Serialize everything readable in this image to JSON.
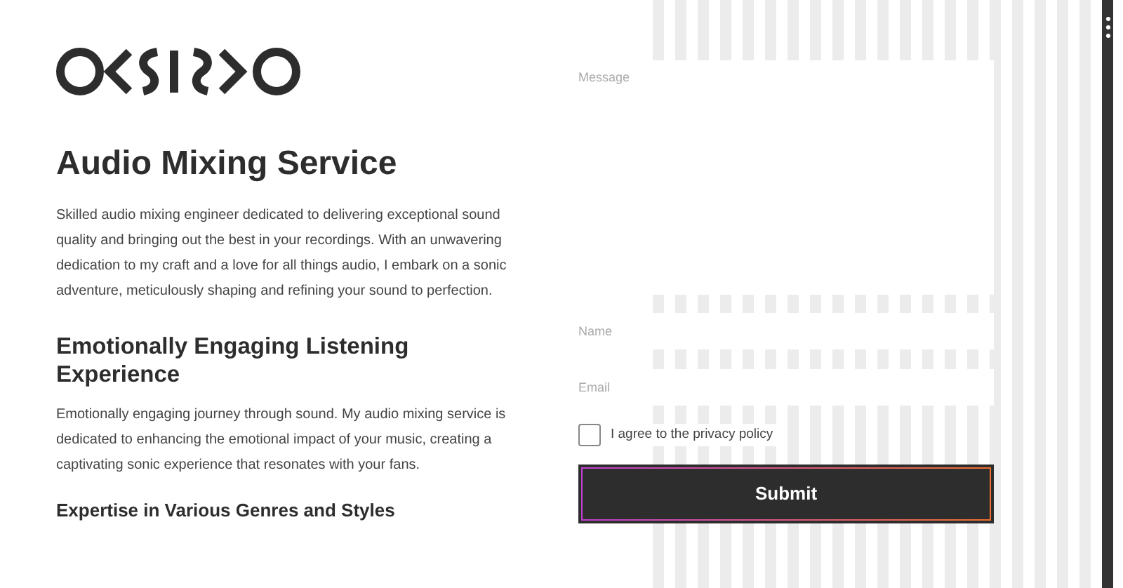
{
  "title": "Audio Mixing Service",
  "intro": "Skilled audio mixing engineer dedicated to delivering exceptional sound quality and bringing out the best in your recordings. With an unwavering dedication to my craft and a love for all things audio, I embark on a sonic adventure, meticulously shaping and refining your sound to perfection.",
  "sections": [
    {
      "heading": "Emotionally Engaging Listening Experience",
      "text": "Emotionally engaging journey through sound. My audio mixing service is dedicated to enhancing the emotional impact of your music, creating a captivating sonic experience that resonates with your fans.",
      "kind": "major"
    },
    {
      "heading": "Expertise in Various Genres and Styles",
      "kind": "minor"
    }
  ],
  "form": {
    "fields": [
      {
        "kind": "textarea",
        "placeholder": "Message"
      },
      {
        "kind": "input",
        "placeholder": "Name"
      },
      {
        "kind": "input",
        "placeholder": "Email"
      }
    ],
    "consent": {
      "label": "I agree to the privacy policy",
      "checked": false
    },
    "submit": "Submit"
  }
}
